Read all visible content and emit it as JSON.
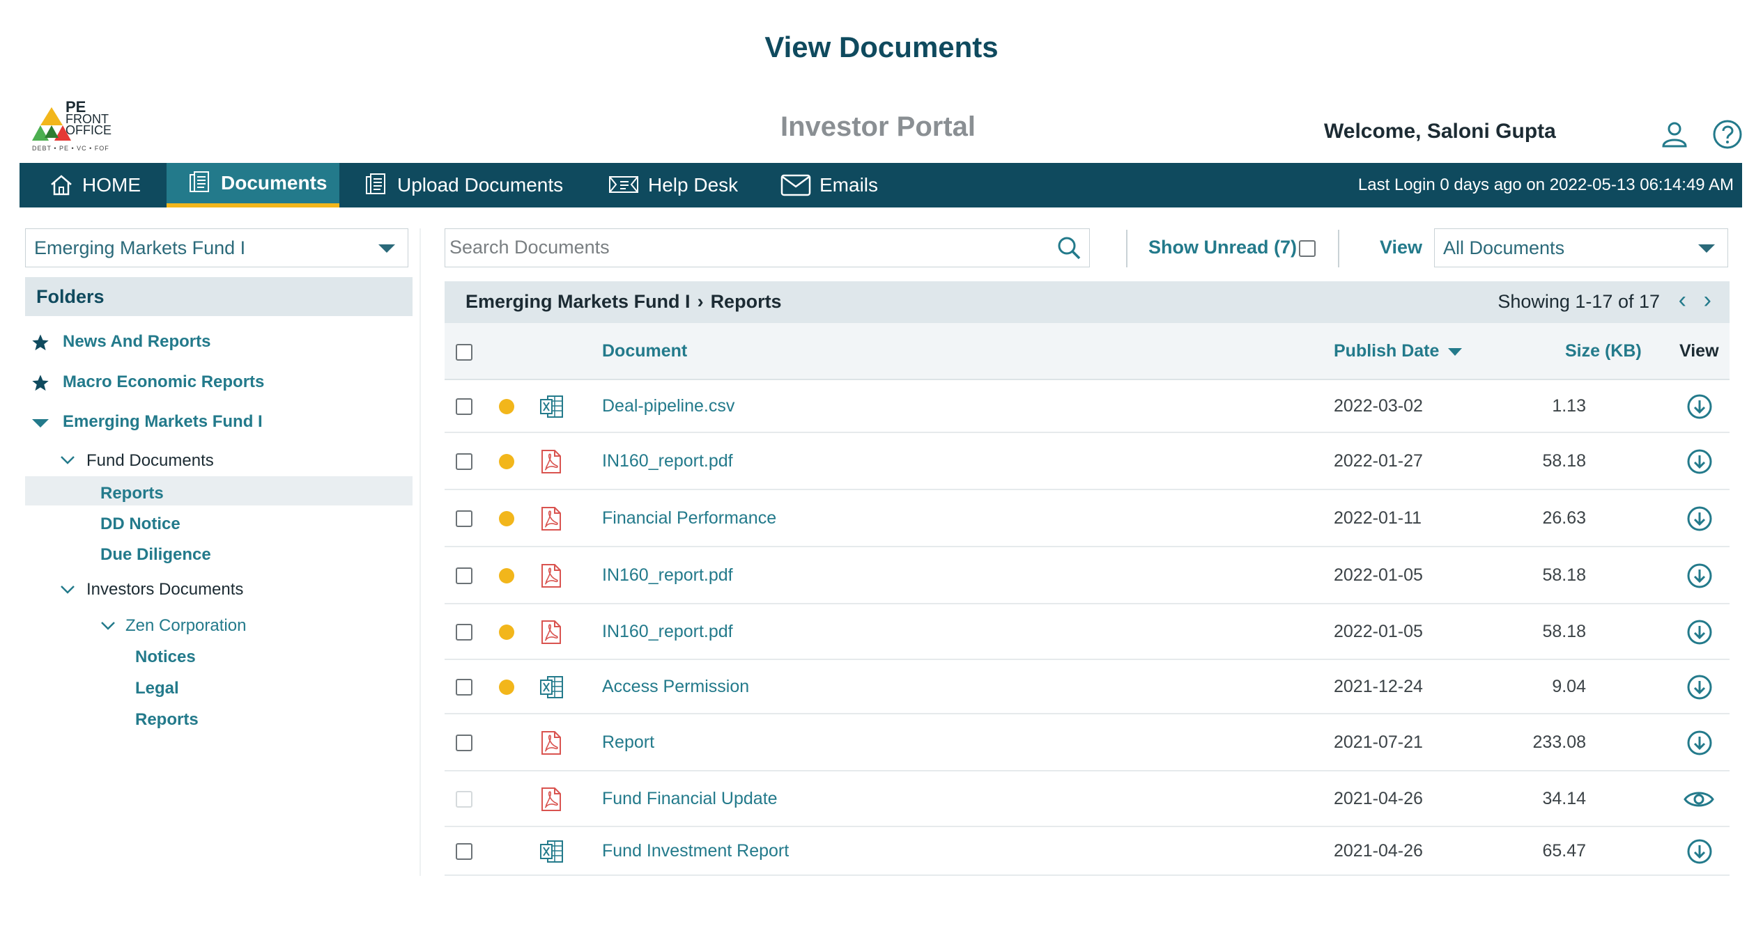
{
  "page": {
    "title": "View Documents"
  },
  "header": {
    "logo": {
      "line1": "PE",
      "line2": "FRONT",
      "line3": "OFFICE",
      "tagline": "DEBT • PE • VC • FOF"
    },
    "portal_title": "Investor Portal",
    "welcome": "Welcome, Saloni Gupta",
    "icons": [
      "user-icon",
      "help-icon"
    ]
  },
  "nav": {
    "items": [
      {
        "label": "HOME",
        "icon": "home-icon"
      },
      {
        "label": "Documents",
        "icon": "documents-icon",
        "active": true
      },
      {
        "label": "Upload Documents",
        "icon": "upload-documents-icon"
      },
      {
        "label": "Help Desk",
        "icon": "help-desk-icon"
      },
      {
        "label": "Emails",
        "icon": "email-icon"
      }
    ],
    "last_login": "Last Login 0 days ago on 2022-05-13 06:14:49 AM"
  },
  "sidebar": {
    "fund_select": "Emerging Markets Fund I",
    "folders_header": "Folders",
    "tree": [
      {
        "label": "News And Reports",
        "icon": "star-icon"
      },
      {
        "label": "Macro Economic Reports",
        "icon": "star-icon"
      },
      {
        "label": "Emerging Markets Fund I",
        "icon": "caret-down-icon"
      },
      {
        "label": "Fund Documents",
        "icon": "chevron-down-icon"
      },
      {
        "label": "Reports",
        "selected": true
      },
      {
        "label": "DD Notice"
      },
      {
        "label": "Due Diligence"
      },
      {
        "label": "Investors Documents",
        "icon": "chevron-down-icon"
      },
      {
        "label": "Zen Corporation",
        "icon": "chevron-down-icon"
      },
      {
        "label": "Notices"
      },
      {
        "label": "Legal"
      },
      {
        "label": "Reports"
      }
    ]
  },
  "toolbar": {
    "search_placeholder": "Search Documents",
    "show_unread": "Show Unread (7)",
    "view_label": "View",
    "view_select": "All Documents"
  },
  "breadcrumb": {
    "fund": "Emerging Markets Fund I",
    "folder": "Reports",
    "showing": "Showing 1-17 of 17"
  },
  "table": {
    "headers": {
      "document": "Document",
      "publish_date": "Publish Date",
      "size": "Size (KB)",
      "view": "View"
    },
    "rows": [
      {
        "name": "Deal-pipeline.csv",
        "date": "2022-03-02",
        "size": "1.13",
        "type": "excel",
        "unread": true,
        "action": "download"
      },
      {
        "name": "IN160_report.pdf",
        "date": "2022-01-27",
        "size": "58.18",
        "type": "pdf",
        "unread": true,
        "action": "download"
      },
      {
        "name": "Financial Performance",
        "date": "2022-01-11",
        "size": "26.63",
        "type": "pdf",
        "unread": true,
        "action": "download"
      },
      {
        "name": "IN160_report.pdf",
        "date": "2022-01-05",
        "size": "58.18",
        "type": "pdf",
        "unread": true,
        "action": "download"
      },
      {
        "name": "IN160_report.pdf",
        "date": "2022-01-05",
        "size": "58.18",
        "type": "pdf",
        "unread": true,
        "action": "download"
      },
      {
        "name": "Access Permission",
        "date": "2021-12-24",
        "size": "9.04",
        "type": "excel",
        "unread": true,
        "action": "download"
      },
      {
        "name": "Report",
        "date": "2021-07-21",
        "size": "233.08",
        "type": "pdf",
        "unread": false,
        "action": "download"
      },
      {
        "name": "Fund Financial Update",
        "date": "2021-04-26",
        "size": "34.14",
        "type": "pdf",
        "unread": false,
        "action": "view",
        "checkbox_disabled": true
      },
      {
        "name": "Fund Investment Report",
        "date": "2021-04-26",
        "size": "65.47",
        "type": "excel",
        "unread": false,
        "action": "download"
      }
    ]
  },
  "colors": {
    "primary": "#0f4a5e",
    "accent": "#237a8b",
    "highlight": "#f2b61b",
    "pdf": "#d9534f",
    "excel": "#237a8b"
  }
}
